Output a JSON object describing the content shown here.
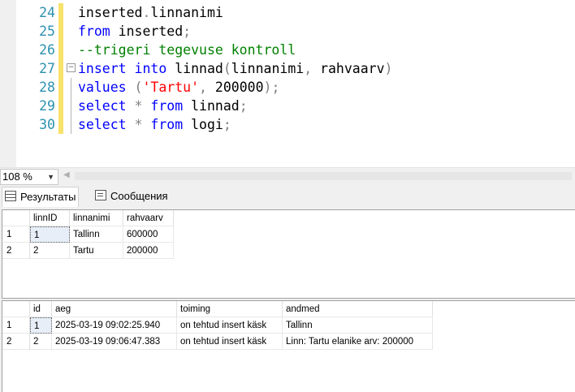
{
  "editor": {
    "lines": [
      {
        "num": "24",
        "tokens": [
          {
            "t": "inserted",
            "c": "n"
          },
          {
            "t": ".",
            "c": "p"
          },
          {
            "t": "linnanimi",
            "c": "n"
          }
        ]
      },
      {
        "num": "25",
        "tokens": [
          {
            "t": "from",
            "c": "k"
          },
          {
            "t": " inserted",
            "c": "n"
          },
          {
            "t": ";",
            "c": "p"
          }
        ]
      },
      {
        "num": "26",
        "tokens": [
          {
            "t": "--trigeri tegevuse kontroll",
            "c": "c"
          }
        ]
      },
      {
        "num": "27",
        "fold": true,
        "tokens": [
          {
            "t": "insert",
            "c": "k"
          },
          {
            "t": " ",
            "c": "n"
          },
          {
            "t": "into",
            "c": "k"
          },
          {
            "t": " linnad",
            "c": "n"
          },
          {
            "t": "(",
            "c": "p"
          },
          {
            "t": "linnanimi",
            "c": "n"
          },
          {
            "t": ", ",
            "c": "p"
          },
          {
            "t": "rahvaarv",
            "c": "n"
          },
          {
            "t": ")",
            "c": "p"
          }
        ]
      },
      {
        "num": "28",
        "tokens": [
          {
            "t": "values",
            "c": "k"
          },
          {
            "t": " (",
            "c": "p"
          },
          {
            "t": "'Tartu'",
            "c": "s"
          },
          {
            "t": ", ",
            "c": "p"
          },
          {
            "t": "200000",
            "c": "n"
          },
          {
            "t": ");",
            "c": "p"
          }
        ]
      },
      {
        "num": "29",
        "tokens": [
          {
            "t": "select",
            "c": "k"
          },
          {
            "t": " * ",
            "c": "p"
          },
          {
            "t": "from",
            "c": "k"
          },
          {
            "t": " linnad",
            "c": "n"
          },
          {
            "t": ";",
            "c": "p"
          }
        ]
      },
      {
        "num": "30",
        "tokens": [
          {
            "t": "select",
            "c": "k"
          },
          {
            "t": " * ",
            "c": "p"
          },
          {
            "t": "from",
            "c": "k"
          },
          {
            "t": " logi",
            "c": "n"
          },
          {
            "t": ";",
            "c": "p"
          }
        ]
      }
    ]
  },
  "zoom": {
    "value": "108 %"
  },
  "tabs": {
    "results": "Результаты",
    "messages": "Сообщения"
  },
  "grid1": {
    "columns": [
      "linnID",
      "linnanimi",
      "rahvaarv"
    ],
    "rows": [
      {
        "n": "1",
        "cells": [
          "1",
          "Tallinn",
          "600000"
        ]
      },
      {
        "n": "2",
        "cells": [
          "2",
          "Tartu",
          "200000"
        ]
      }
    ]
  },
  "grid2": {
    "columns": [
      "id",
      "aeg",
      "toiming",
      "andmed"
    ],
    "rows": [
      {
        "n": "1",
        "cells": [
          "1",
          "2025-03-19 09:02:25.940",
          "on tehtud insert käsk",
          "Tallinn"
        ]
      },
      {
        "n": "2",
        "cells": [
          "2",
          "2025-03-19 09:06:47.383",
          "on tehtud insert käsk",
          "Linn: Tartu elanike arv: 200000"
        ]
      }
    ]
  }
}
